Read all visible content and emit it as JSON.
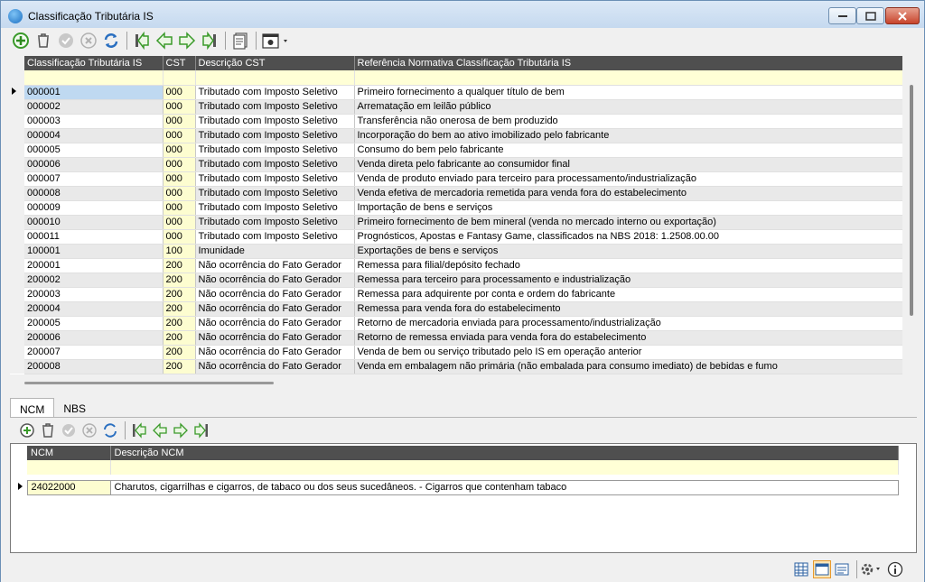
{
  "window": {
    "title": "Classificação Tributária IS"
  },
  "main_grid": {
    "columns": [
      "Classificação Tributária IS",
      "CST",
      "Descrição CST",
      "Referência Normativa Classificação Tributária IS"
    ],
    "rows": [
      {
        "code": "000001",
        "cst": "000",
        "desc": "Tributado com Imposto Seletivo",
        "ref": "Primeiro fornecimento a qualquer título de bem"
      },
      {
        "code": "000002",
        "cst": "000",
        "desc": "Tributado com Imposto Seletivo",
        "ref": "Arrematação em leilão público"
      },
      {
        "code": "000003",
        "cst": "000",
        "desc": "Tributado com Imposto Seletivo",
        "ref": "Transferência não onerosa de bem produzido"
      },
      {
        "code": "000004",
        "cst": "000",
        "desc": "Tributado com Imposto Seletivo",
        "ref": "Incorporação do bem ao ativo imobilizado pelo fabricante"
      },
      {
        "code": "000005",
        "cst": "000",
        "desc": "Tributado com Imposto Seletivo",
        "ref": "Consumo do bem pelo fabricante"
      },
      {
        "code": "000006",
        "cst": "000",
        "desc": "Tributado com Imposto Seletivo",
        "ref": "Venda direta pelo fabricante ao consumidor final"
      },
      {
        "code": "000007",
        "cst": "000",
        "desc": "Tributado com Imposto Seletivo",
        "ref": "Venda de produto enviado para terceiro para processamento/industrialização"
      },
      {
        "code": "000008",
        "cst": "000",
        "desc": "Tributado com Imposto Seletivo",
        "ref": "Venda efetiva de mercadoria remetida para venda fora do estabelecimento"
      },
      {
        "code": "000009",
        "cst": "000",
        "desc": "Tributado com Imposto Seletivo",
        "ref": "Importação de bens e serviços"
      },
      {
        "code": "000010",
        "cst": "000",
        "desc": "Tributado com Imposto Seletivo",
        "ref": "Primeiro fornecimento de bem mineral (venda no mercado interno ou exportação)"
      },
      {
        "code": "000011",
        "cst": "000",
        "desc": "Tributado com Imposto Seletivo",
        "ref": "Prognósticos, Apostas e Fantasy Game, classificados na NBS 2018: 1.2508.00.00"
      },
      {
        "code": "100001",
        "cst": "100",
        "desc": "Imunidade",
        "ref": "Exportações de bens e serviços"
      },
      {
        "code": "200001",
        "cst": "200",
        "desc": "Não ocorrência do Fato Gerador",
        "ref": "Remessa para filial/depósito fechado"
      },
      {
        "code": "200002",
        "cst": "200",
        "desc": "Não ocorrência do Fato Gerador",
        "ref": "Remessa para terceiro para processamento e industrialização"
      },
      {
        "code": "200003",
        "cst": "200",
        "desc": "Não ocorrência do Fato Gerador",
        "ref": "Remessa para adquirente por conta e ordem do fabricante"
      },
      {
        "code": "200004",
        "cst": "200",
        "desc": "Não ocorrência do Fato Gerador",
        "ref": "Remessa para venda fora do estabelecimento"
      },
      {
        "code": "200005",
        "cst": "200",
        "desc": "Não ocorrência do Fato Gerador",
        "ref": "Retorno de mercadoria enviada para processamento/industrialização"
      },
      {
        "code": "200006",
        "cst": "200",
        "desc": "Não ocorrência do Fato Gerador",
        "ref": "Retorno de remessa enviada para venda fora do estabelecimento"
      },
      {
        "code": "200007",
        "cst": "200",
        "desc": "Não ocorrência do Fato Gerador",
        "ref": "Venda de bem ou serviço tributado pelo IS em operação anterior"
      },
      {
        "code": "200008",
        "cst": "200",
        "desc": "Não ocorrência do Fato Gerador",
        "ref": "Venda em embalagem não primária (não embalada para consumo imediato) de bebidas e fumo"
      }
    ]
  },
  "tabs": [
    "NCM",
    "NBS"
  ],
  "ncm_grid": {
    "columns": [
      "NCM",
      "Descrição NCM"
    ],
    "rows": [
      {
        "ncm": "24022000",
        "desc": "Charutos, cigarrilhas e cigarros, de tabaco ou dos seus sucedâneos. - Cigarros que contenham tabaco"
      }
    ]
  },
  "icons": {
    "toolbar": [
      "add-icon",
      "delete-icon",
      "confirm-icon",
      "cancel-icon",
      "refresh-icon",
      "first-record-icon",
      "previous-record-icon",
      "next-record-icon",
      "last-record-icon",
      "report-icon",
      "settings-icon"
    ],
    "statusbar": [
      "grid-view-icon",
      "form-view-icon",
      "detail-view-icon",
      "gear-icon",
      "info-icon"
    ]
  },
  "colors": {
    "header_bg": "#4f4f4f",
    "filter_row": "#ffffd6",
    "selected_cell": "#bfd9f1",
    "cst_column": "#fdfdd0",
    "green_icons": "#3a9a2a",
    "close_button": "#c8442c"
  }
}
